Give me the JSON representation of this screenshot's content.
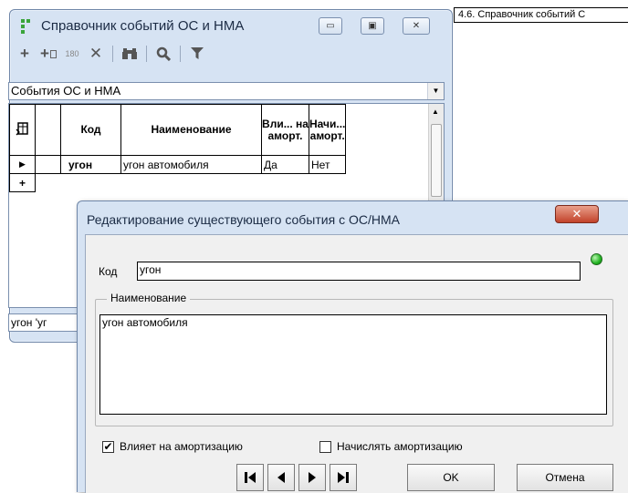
{
  "caption": "4.6. Справочник событий С",
  "main_window": {
    "title": "Справочник событий ОС и НМА",
    "controls": {
      "minimize": "▭",
      "maximize": "▣",
      "close": "✕"
    },
    "toolbar": {
      "add_icon": "+",
      "add_copy_icon": "+",
      "rotate_label": "180",
      "delete_icon": "✕",
      "binoculars_icon": "binoculars",
      "search_icon": "magnifier",
      "filter_icon": "funnel"
    },
    "combo_value": "События ОС и НМА",
    "grid": {
      "columns": {
        "code": "Код",
        "name": "Наименование",
        "affects": "Вли... на аморт.",
        "charge": "Начи... аморт."
      },
      "rows": [
        {
          "code": "угон",
          "name": "угон автомобиля",
          "affects": "Да",
          "charge": "Нет"
        }
      ],
      "current_marker": "▶",
      "new_row_marker": "+"
    },
    "status_text": "угон 'уг"
  },
  "dialog": {
    "title": "Редактирование существующего события с ОС/НМА",
    "code_label": "Код",
    "code_value": "угон",
    "name_group_label": "Наименование",
    "name_value": "угон автомобиля",
    "affects_label": "Влияет на амортизацию",
    "affects_checked": true,
    "charge_label": "Начислять амортизацию",
    "charge_checked": false,
    "ok_label": "OK",
    "cancel_label": "Отмена"
  }
}
